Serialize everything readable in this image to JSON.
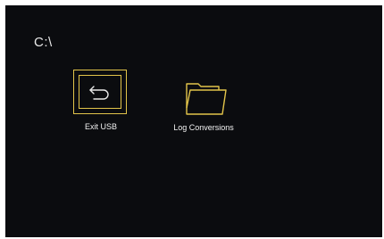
{
  "screen": {
    "path": "C:\\"
  },
  "items": [
    {
      "label": "Exit USB",
      "icon": "exit-return-icon",
      "accent": "#e2c44a",
      "selected": true
    },
    {
      "label": "Log Conversions",
      "icon": "folder-icon",
      "accent": "#e2c44a",
      "selected": false
    }
  ],
  "colors": {
    "background": "#0b0c0f",
    "text": "#f2f2f2",
    "accent": "#e2c44a"
  }
}
